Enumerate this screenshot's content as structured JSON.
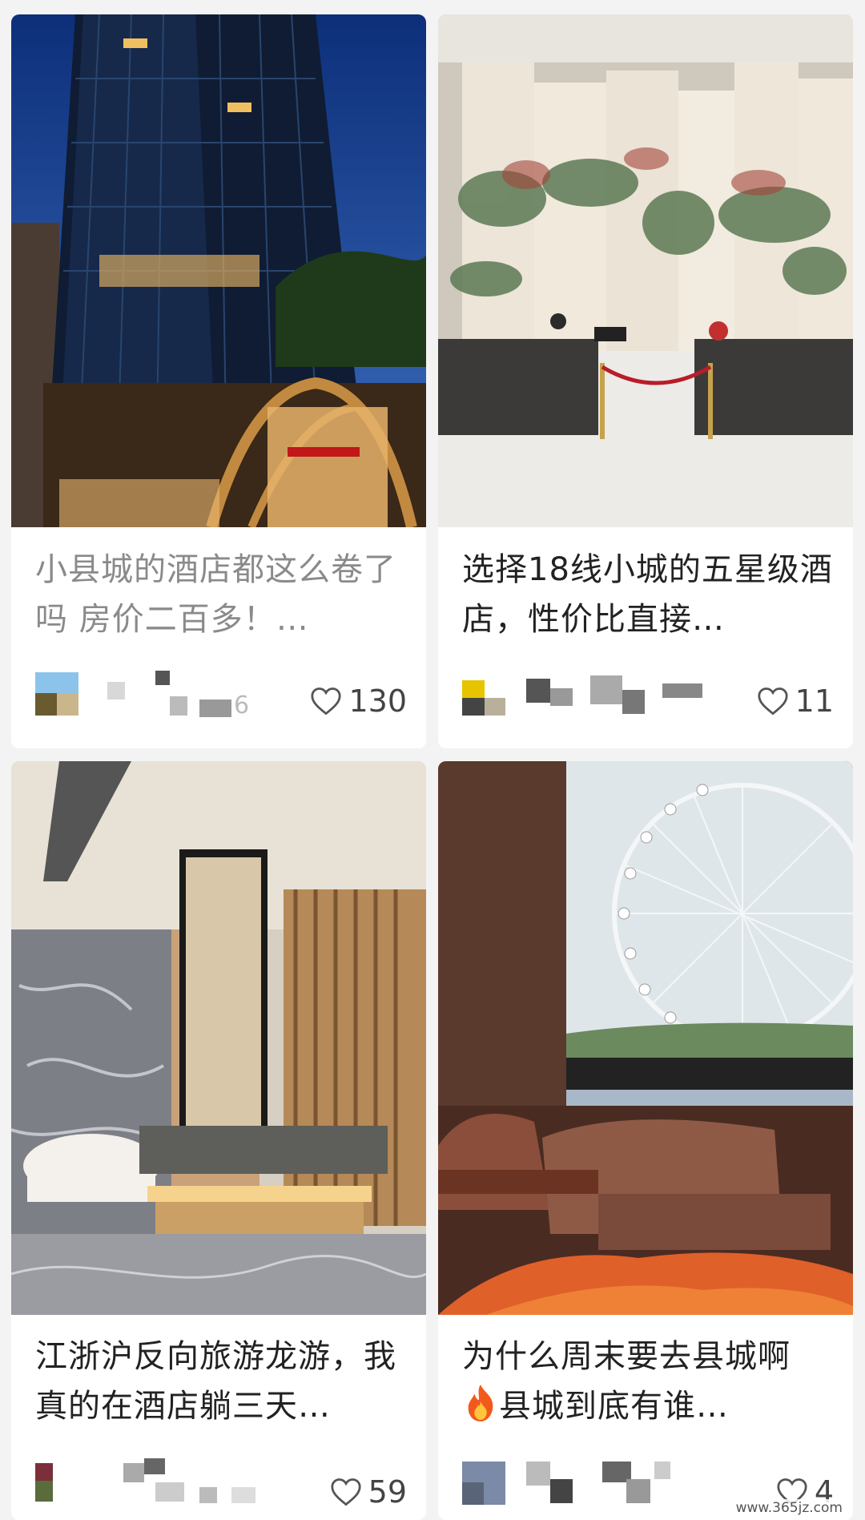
{
  "feed": {
    "cards": [
      {
        "title": "小县城的酒店都这么卷了吗 房价二百多！…",
        "likes": "130",
        "image": "hotel-tower-exterior-at-dusk"
      },
      {
        "title": "选择18线小城的五星级酒店，性价比直接…",
        "likes": "11",
        "image": "hotel-lobby-reception-with-landscape-mural"
      },
      {
        "title": "江浙沪反向旅游龙游，我真的在酒店躺三天…",
        "likes": "59",
        "image": "hotel-bathroom-with-bathtub-and-mirror"
      },
      {
        "title_emoji": "fire-icon",
        "title_line1": "为什么周末要去县城啊",
        "title_line2": "县城到底有谁…",
        "likes": "4",
        "image": "hotel-room-window-ferris-wheel"
      }
    ]
  },
  "author_partial_text": "6",
  "watermark": "www.365jz.com",
  "icons": {
    "like": "heart-outline-icon"
  },
  "colors": {
    "background": "#f3f3f3",
    "card": "#ffffff",
    "title": "#222222",
    "title_muted": "#8a8a8a"
  }
}
